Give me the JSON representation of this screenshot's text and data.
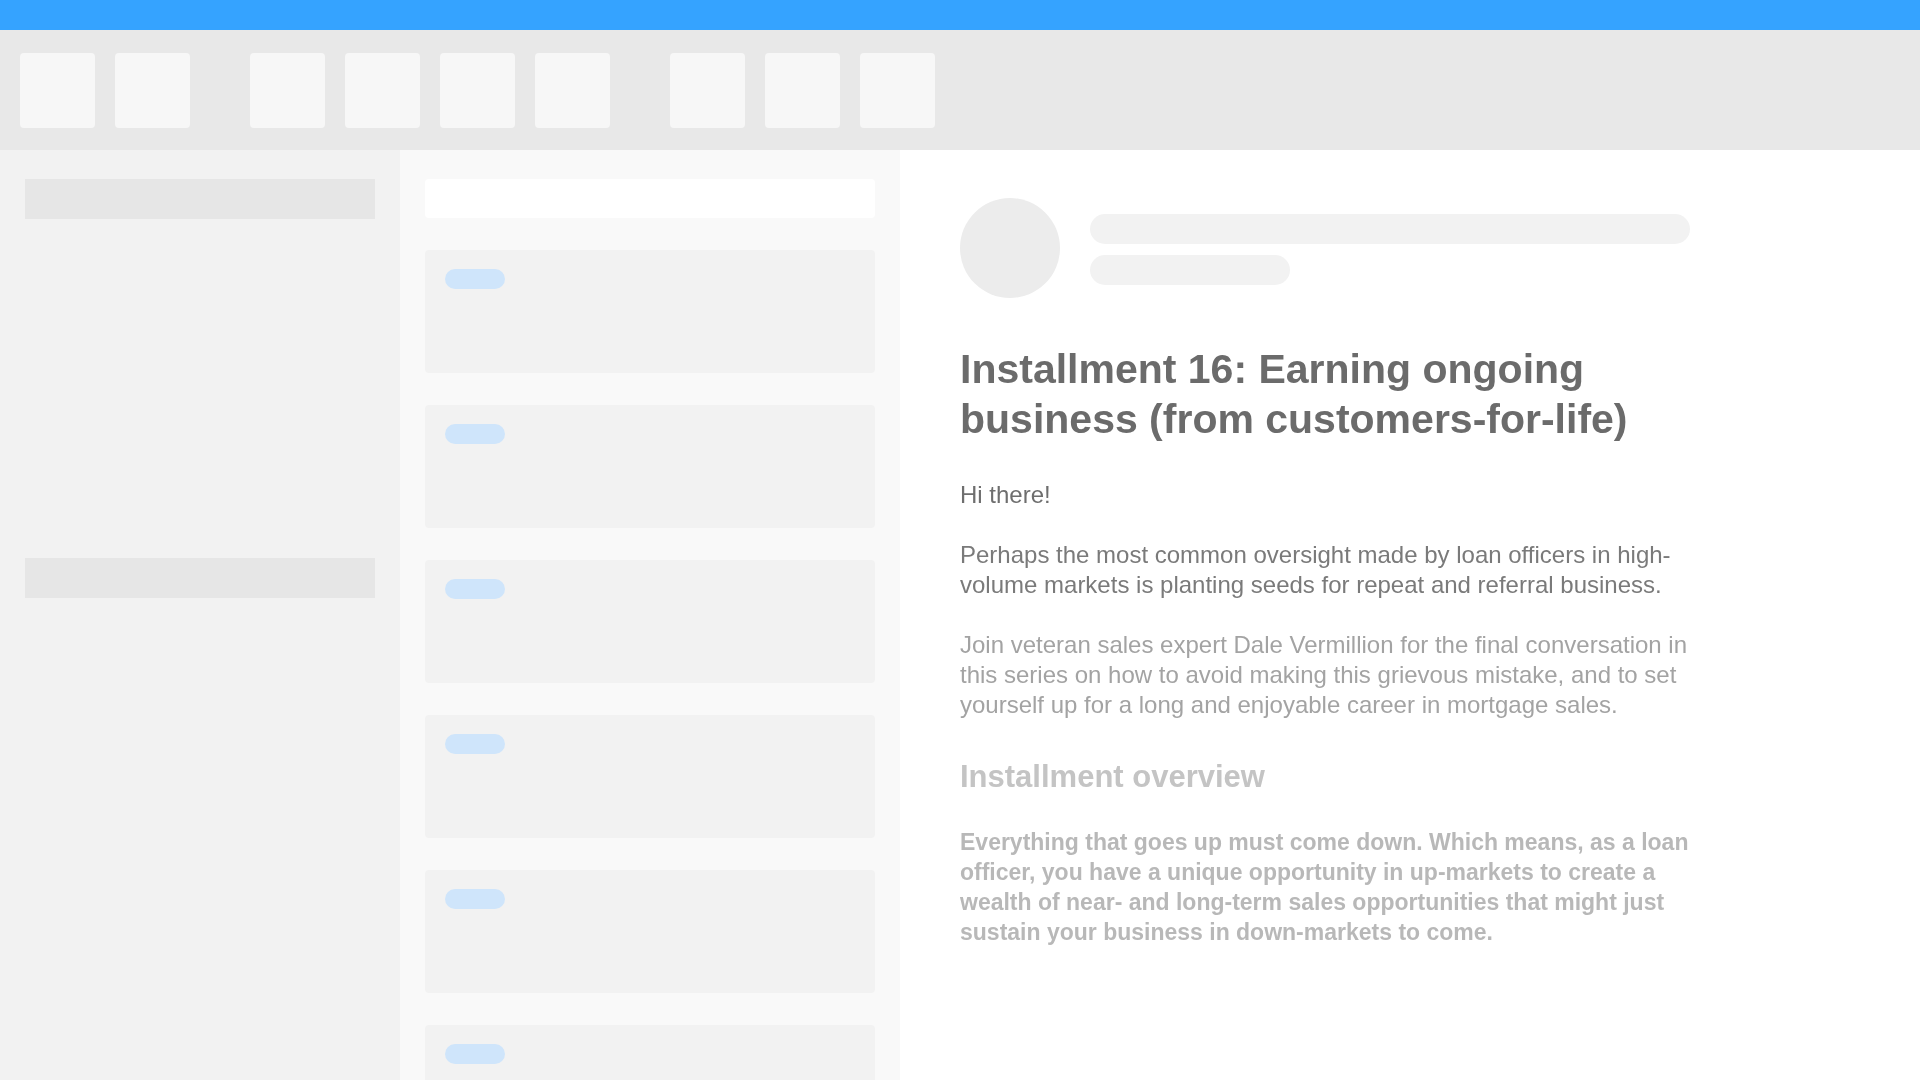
{
  "article": {
    "title": "Installment 16: Earning ongoing business (from customers-for-life)",
    "paragraphs": [
      {
        "kind": "greeting",
        "text": "Hi there!"
      },
      {
        "kind": "body",
        "text": "Perhaps the most common oversight made by loan officers in high-volume markets is planting seeds for repeat and referral business."
      },
      {
        "kind": "faded",
        "text": "Join veteran sales expert Dale Vermillion for the final conversation in this series on how to avoid making this grievous mistake, and to set yourself up for a long and enjoyable career in mortgage sales."
      }
    ],
    "section_heading": "Installment overview",
    "overview": "Everything that goes up must come down. Which means, as a loan officer, you have a unique opportunity in up-markets to create a wealth of near- and long-term sales opportunities that might just sustain your business in down-markets to come."
  }
}
